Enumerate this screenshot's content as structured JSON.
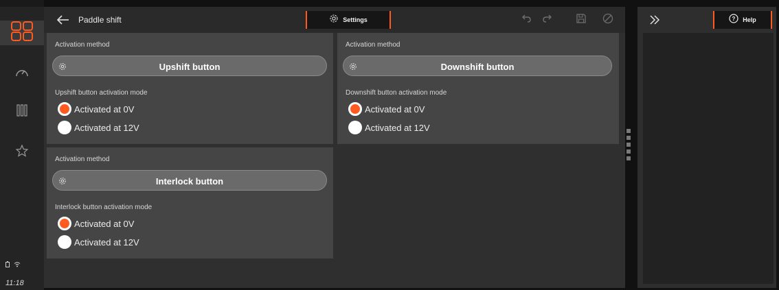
{
  "header": {
    "title": "Paddle shift",
    "active_tab": "Settings"
  },
  "rail": {
    "items": [
      {
        "icon": "apps-grid-icon",
        "active": true
      },
      {
        "icon": "gauge-icon",
        "active": false
      },
      {
        "icon": "columns-icon",
        "active": false
      },
      {
        "icon": "star-icon",
        "active": false
      }
    ],
    "clock": "11:18"
  },
  "cards": [
    {
      "section_label": "Activation method",
      "button_label": "Upshift button",
      "mode_label": "Upshift button activation mode",
      "options": [
        "Activated at 0V",
        "Activated at 12V"
      ],
      "selected": 0
    },
    {
      "section_label": "Activation method",
      "button_label": "Downshift button",
      "mode_label": "Downshift button activation mode",
      "options": [
        "Activated at 0V",
        "Activated at 12V"
      ],
      "selected": 0
    },
    {
      "section_label": "Activation method",
      "button_label": "Interlock button",
      "mode_label": "Interlock button activation mode",
      "options": [
        "Activated at 0V",
        "Activated at 12V"
      ],
      "selected": 0
    }
  ],
  "side_panel": {
    "help_label": "Help"
  },
  "colors": {
    "accent": "#ff5a1f",
    "background": "#2f2f2f",
    "card": "#454545"
  }
}
